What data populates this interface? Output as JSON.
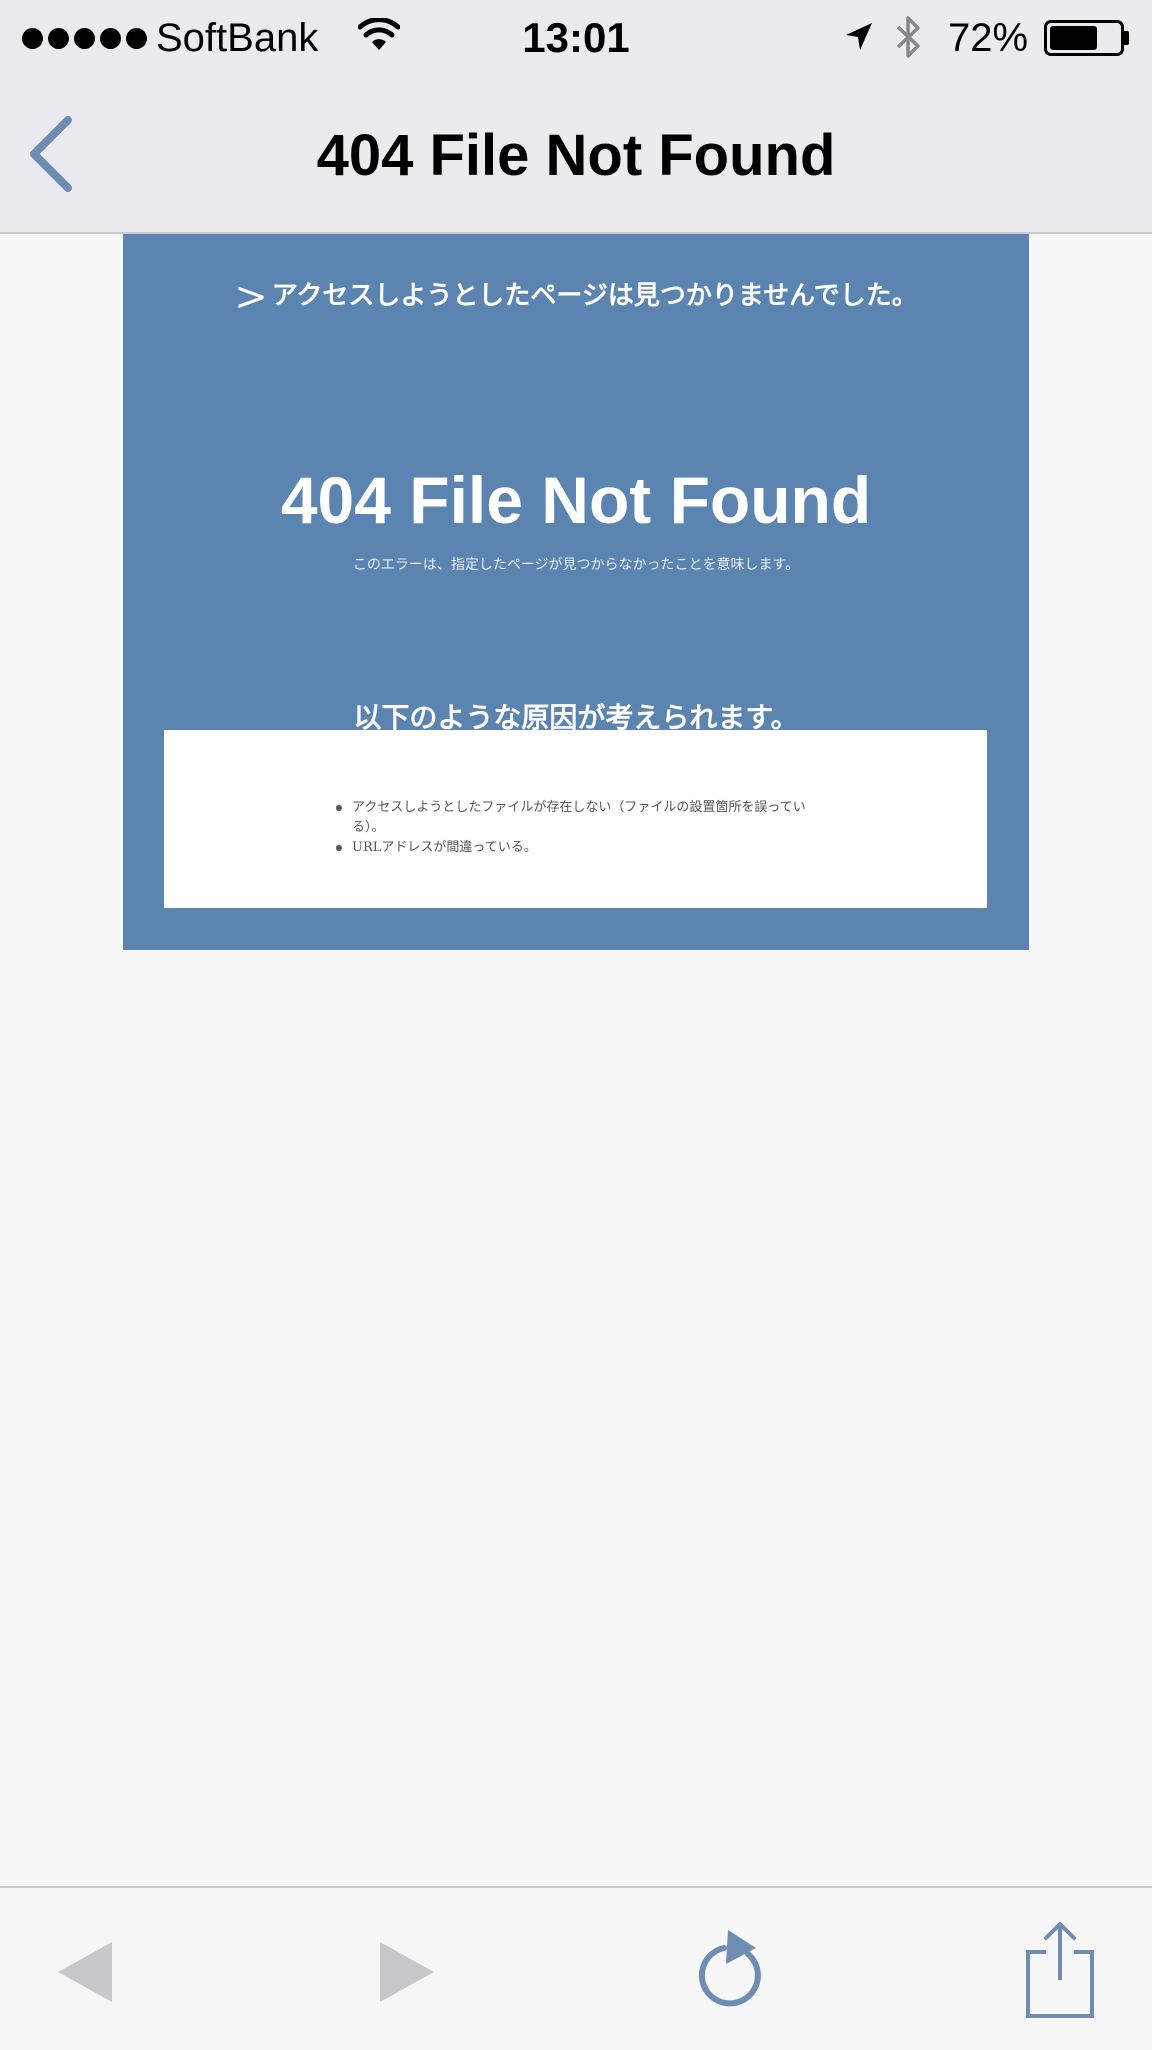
{
  "status_bar": {
    "carrier": "SoftBank",
    "time": "13:01",
    "battery_percent": "72%",
    "battery_level": 0.72,
    "signal_bars": 5,
    "icons": [
      "signal-dots-icon",
      "wifi-icon",
      "location-arrow-icon",
      "bluetooth-icon",
      "battery-icon"
    ]
  },
  "nav": {
    "back_icon": "chevron-left-icon",
    "title": "404 File Not Found"
  },
  "page": {
    "intro_marker": ">",
    "intro_text": "アクセスしようとしたページは見つかりませんでした。",
    "error_title": "404 File Not Found",
    "error_subtitle": "このエラーは、指定したページが見つからなかったことを意味します。",
    "causes_heading": "以下のような原因が考えられます。",
    "causes": [
      "アクセスしようとしたファイルが存在しない（ファイルの設置箇所を誤っている）。",
      "URLアドレスが間違っている。"
    ]
  },
  "toolbar": {
    "icons": [
      "back-triangle-icon",
      "forward-triangle-icon",
      "reload-icon",
      "share-icon"
    ]
  },
  "colors": {
    "panel_blue": "#5b84b1",
    "accent": "#6f8cb3",
    "bar_bg": "#ebebef",
    "disabled": "#c7c7cc"
  }
}
